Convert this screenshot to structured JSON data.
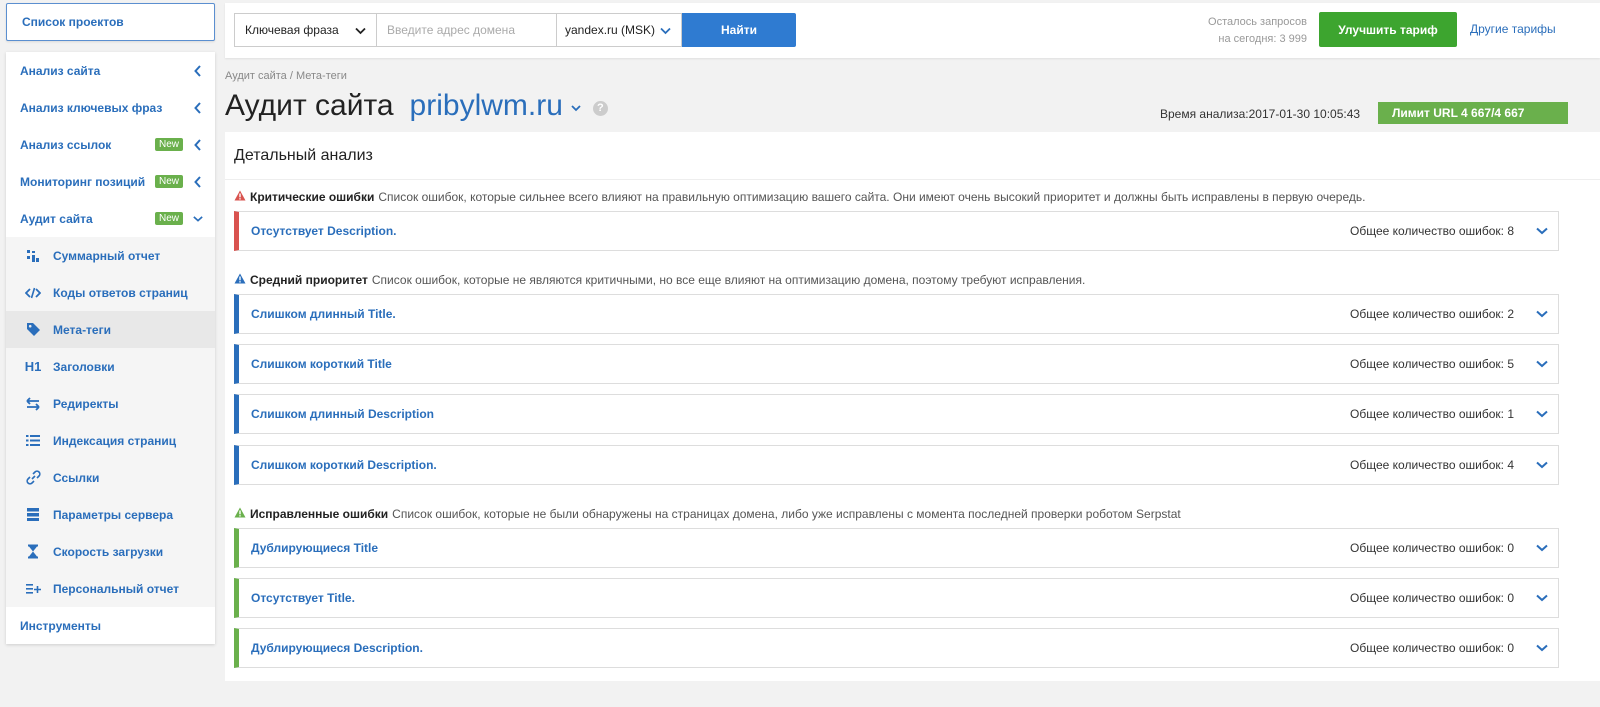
{
  "sidebar": {
    "projects_label": "Список проектов",
    "items": [
      {
        "label": "Анализ сайта"
      },
      {
        "label": "Анализ ключевых фраз"
      },
      {
        "label": "Анализ ссылок",
        "badge": "New"
      },
      {
        "label": "Мониторинг позиций",
        "badge": "New"
      },
      {
        "label": "Аудит сайта",
        "badge": "New"
      }
    ],
    "subitems": [
      {
        "label": "Суммарный отчет",
        "icon": "summary-icon"
      },
      {
        "label": "Коды ответов страниц",
        "icon": "code-icon"
      },
      {
        "label": "Мета-теги",
        "icon": "tag-icon",
        "active": true
      },
      {
        "label": "Заголовки",
        "icon": "h1-icon",
        "icon_text": "H1"
      },
      {
        "label": "Редиректы",
        "icon": "redirect-arrows-icon"
      },
      {
        "label": "Индексация страниц",
        "icon": "list-icon"
      },
      {
        "label": "Ссылки",
        "icon": "link-icon"
      },
      {
        "label": "Параметры сервера",
        "icon": "server-icon"
      },
      {
        "label": "Скорость загрузки",
        "icon": "hourglass-icon"
      },
      {
        "label": "Персональный отчет",
        "icon": "list-plus-icon"
      }
    ],
    "tools_label": "Инструменты"
  },
  "topbar": {
    "keyword_select": "Ключевая фраза",
    "domain_placeholder": "Введите адрес домена",
    "search_engine": "yandex.ru (MSK)",
    "find_label": "Найти",
    "remaining_line1": "Осталось запросов",
    "remaining_line2": "на сегодня: 3 999",
    "upgrade_label": "Улучшить тариф",
    "other_tariffs": "Другие тарифы"
  },
  "header": {
    "breadcrumb": "Аудит сайта / Мета-теги",
    "title": "Аудит сайта",
    "domain": "pribylwm.ru",
    "analysis_time": "Время анализа:2017-01-30 10:05:43",
    "limit": "Лимит URL 4 667/4 667"
  },
  "panel": {
    "title": "Детальный анализ",
    "critical": {
      "title": "Критические ошибки",
      "desc": "Список ошибок, которые сильнее всего влияют на правильную оптимизацию вашего сайта. Они имеют очень высокий приоритет и должны быть исправлены в первую очередь.",
      "rows": [
        {
          "name": "Отсутствует Description.",
          "count": "Общее количество ошибок: 8"
        }
      ]
    },
    "medium": {
      "title": "Средний приоритет",
      "desc": "Список ошибок, которые не являются критичными, но все еще влияют на оптимизацию домена, поэтому требуют исправления.",
      "rows": [
        {
          "name": "Слишком длинный Title.",
          "count": "Общее количество ошибок: 2"
        },
        {
          "name": "Слишком короткий Title",
          "count": "Общее количество ошибок: 5"
        },
        {
          "name": "Слишком длинный Description",
          "count": "Общее количество ошибок: 1"
        },
        {
          "name": "Слишком короткий Description.",
          "count": "Общее количество ошибок: 4"
        }
      ]
    },
    "fixed": {
      "title": "Исправленные ошибки",
      "desc": "Список ошибок, которые не были обнаружены на страницах домена, либо уже исправлены с момента последней проверки роботом Serpstat",
      "rows": [
        {
          "name": "Дублирующиеся Title",
          "count": "Общее количество ошибок: 0"
        },
        {
          "name": "Отсутствует Title.",
          "count": "Общее количество ошибок: 0"
        },
        {
          "name": "Дублирующиеся Description.",
          "count": "Общее количество ошибок: 0"
        }
      ]
    }
  },
  "colors": {
    "accent": "#2a6ebb",
    "critical": "#d9534f",
    "medium": "#2a6ebb",
    "fixed": "#6ab04c",
    "upgrade": "#3da52f"
  }
}
